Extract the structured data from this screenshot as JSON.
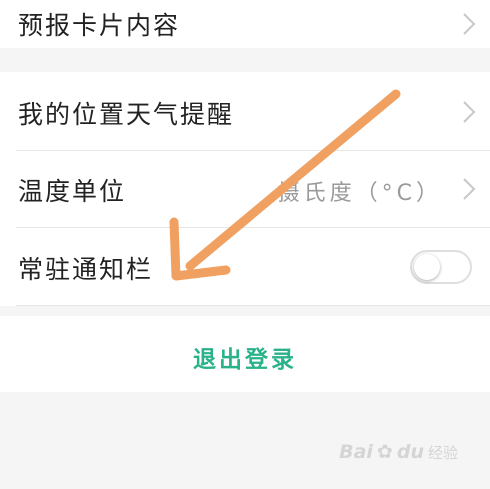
{
  "rows": {
    "forecast_card": {
      "label": "预报卡片内容"
    },
    "location_alert": {
      "label": "我的位置天气提醒"
    },
    "temp_unit": {
      "label": "温度单位",
      "value": "摄氏度（°C）"
    },
    "notification_bar": {
      "label": "常驻通知栏",
      "toggle_on": false
    }
  },
  "logout": {
    "label": "退出登录"
  },
  "watermark": {
    "logo": "Bai",
    "paw": "✿",
    "logo2": "du",
    "text": "经验"
  },
  "colors": {
    "accent_green": "#2bb28a",
    "arrow_orange": "#f0a060",
    "background": "#f5f5f5",
    "card": "#ffffff"
  },
  "icons": {
    "chevron": "chevron-right-icon",
    "arrow": "annotation-arrow-icon"
  }
}
